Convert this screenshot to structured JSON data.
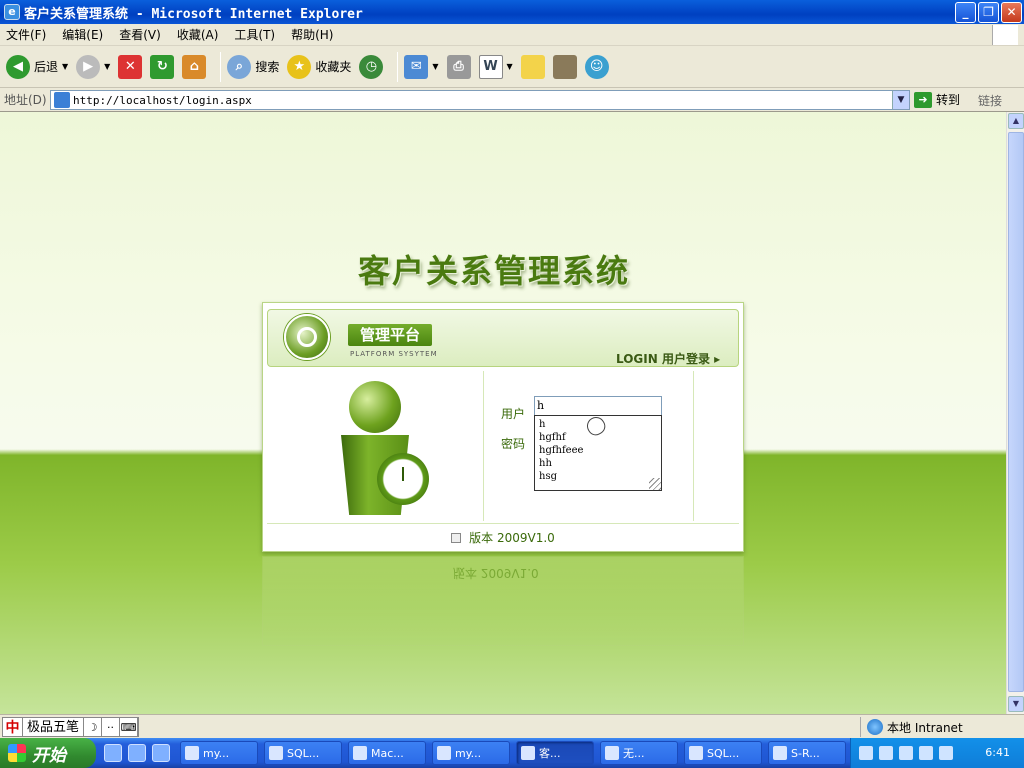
{
  "window": {
    "title": "客户关系管理系统 - Microsoft Internet Explorer",
    "app_letter": "e"
  },
  "menu": {
    "file": "文件(F)",
    "edit": "编辑(E)",
    "view": "查看(V)",
    "favorites": "收藏(A)",
    "tools": "工具(T)",
    "help": "帮助(H)"
  },
  "toolbar": {
    "back": "后退",
    "search": "搜索",
    "favorites": "收藏夹"
  },
  "address": {
    "label": "地址(D)",
    "url": "http://localhost/login.aspx",
    "go": "转到",
    "links": "链接"
  },
  "page": {
    "system_name": "客户关系管理系统",
    "platform": "管理平台",
    "platform_sub": "PLATFORM SYSYTEM",
    "login_label": "LOGIN 用户登录 ▸",
    "user_label": "用户",
    "password_label": "密码",
    "username_value": "h",
    "autocomplete": [
      "h",
      "hgfhf",
      "hgfhfeee",
      "hh",
      "hsg"
    ],
    "version": "版本 2009V1.0",
    "reflect_version": "版本 2009V1.0"
  },
  "status": {
    "ime_char": "中",
    "ime_name": "极品五笔",
    "ime_moon": "☽",
    "ime_dots": "··",
    "ime_kbd": "⌨",
    "zone": "本地 Intranet"
  },
  "taskbar": {
    "start": "开始",
    "tasks": [
      {
        "label": "my..."
      },
      {
        "label": "SQL..."
      },
      {
        "label": "Mac..."
      },
      {
        "label": "my..."
      },
      {
        "label": "客..."
      },
      {
        "label": "无..."
      },
      {
        "label": "SQL..."
      },
      {
        "label": "S-R..."
      }
    ],
    "clock": "6:41"
  }
}
